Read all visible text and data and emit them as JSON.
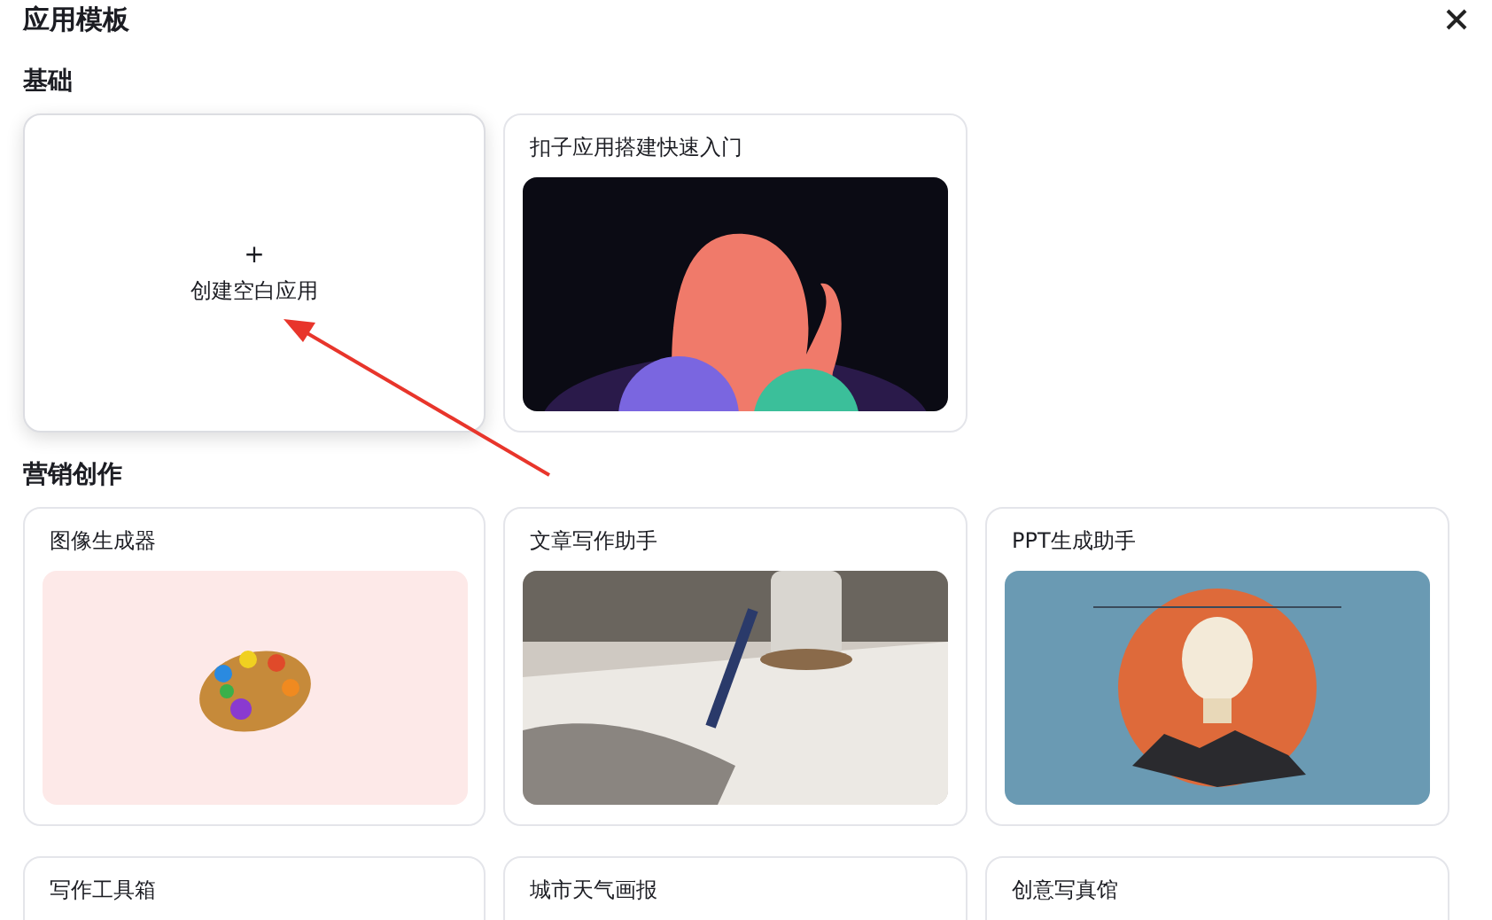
{
  "window": {
    "title": "应用模板"
  },
  "sections": [
    {
      "heading": "基础",
      "cards": [
        {
          "kind": "blank",
          "plus": "+",
          "label": "创建空白应用",
          "highlighted": true
        },
        {
          "kind": "picture",
          "title": "扣子应用搭建快速入门",
          "highlighted": false
        }
      ]
    },
    {
      "heading": "营销创作",
      "cards": [
        {
          "kind": "picture",
          "title": "图像生成器",
          "highlighted": false
        },
        {
          "kind": "picture",
          "title": "文章写作助手",
          "highlighted": false
        },
        {
          "kind": "picture",
          "title": "PPT生成助手",
          "highlighted": false
        },
        {
          "kind": "titled",
          "title": "写作工具箱",
          "highlighted": false
        },
        {
          "kind": "titled",
          "title": "城市天气画报",
          "highlighted": false
        },
        {
          "kind": "titled",
          "title": "创意写真馆",
          "highlighted": false
        }
      ]
    }
  ]
}
